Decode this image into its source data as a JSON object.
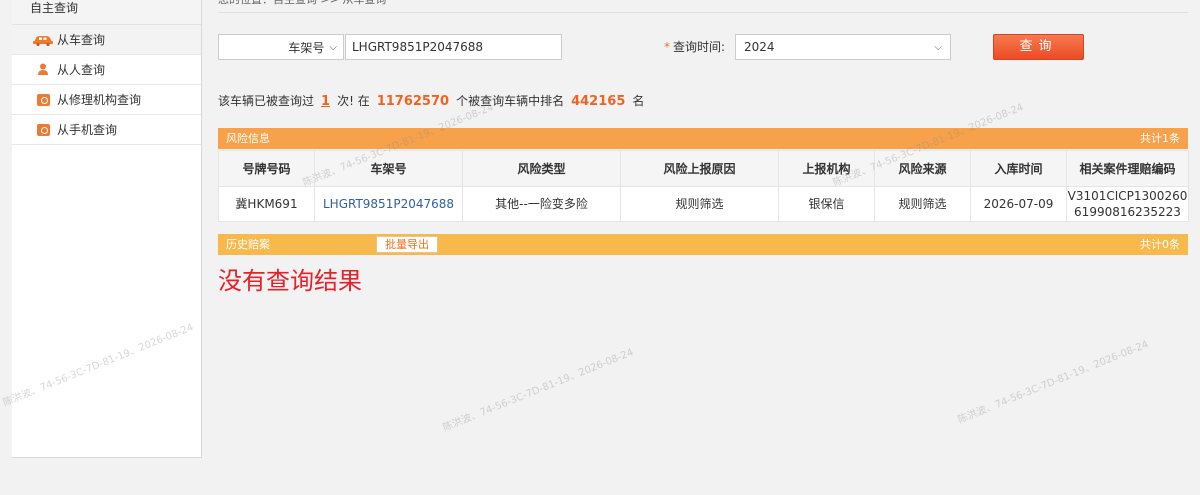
{
  "sidebar": {
    "title": "自主查询",
    "items": [
      {
        "label": "从车查询",
        "icon": "car-icon"
      },
      {
        "label": "从人查询",
        "icon": "person-icon"
      },
      {
        "label": "从修理机构查询",
        "icon": "repair-shop-icon"
      },
      {
        "label": "从手机查询",
        "icon": "phone-icon"
      }
    ]
  },
  "breadcrumb": "您的位置：自主查询 >> 从车查询",
  "search": {
    "type_value": "车架号",
    "vin_value": "LHGRT9851P2047688",
    "time_label": "查询时间:",
    "time_required_mark": "*",
    "year_value": "2024",
    "query_button": "查询"
  },
  "summary": {
    "prefix": "该车辆已被查询过",
    "count": "1",
    "mid1": "次! 在",
    "total": "11762570",
    "mid2": "个被查询车辆中排名",
    "rank": "442165",
    "suffix": "名"
  },
  "risk": {
    "title": "风险信息",
    "total": "共计1条",
    "headers": [
      "号牌号码",
      "车架号",
      "风险类型",
      "风险上报原因",
      "上报机构",
      "风险来源",
      "入库时间",
      "相关案件理赔编码"
    ],
    "rows": [
      {
        "plate": "冀HKM691",
        "vin": "LHGRT9851P2047688",
        "risk_type": "其他--一险变多险",
        "reason": "规则筛选",
        "org": "银保信",
        "source": "规则筛选",
        "date": "2026-07-09",
        "claim_code": "V3101CICP130026061990816235223"
      }
    ]
  },
  "history": {
    "title": "历史赔案",
    "export_button": "批量导出",
    "total": "共计0条",
    "empty_message": "没有查询结果"
  },
  "watermark_text": "陈洪波、74-56-3C-7D-81-19、2026-08-24",
  "colors": {
    "accent": "#f06322",
    "risk_bar": "#f7a14a",
    "history_bar": "#f8b94c",
    "query_button": "#f1582f",
    "empty_message": "#e8202a",
    "link": "#2f60a7"
  }
}
